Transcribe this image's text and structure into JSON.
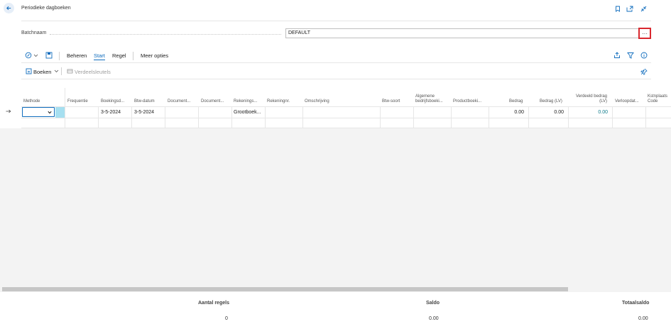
{
  "header": {
    "title": "Periodieke dagboeken"
  },
  "batch": {
    "label": "Batchnaam",
    "value": "DEFAULT",
    "lookup_label": "···"
  },
  "toolbar": {
    "manage": "Beheren",
    "start": "Start",
    "line": "Regel",
    "more": "Meer opties"
  },
  "subbar": {
    "post": "Boeken",
    "allocation": "Verdeelsleutels"
  },
  "columns": {
    "method": "Methode",
    "frequency": "Frequentie",
    "posting_date": "Boekingsd...",
    "vat_date": "Btw-datum",
    "doc_type": "Document...",
    "doc_no": "Document...",
    "account_type": "Rekenings...",
    "account_no": "Rekeningnr.",
    "description": "Omschrijving",
    "vat_type": "Btw-soort",
    "gen_bus_line1": "Algemene",
    "gen_bus_line2": "bedrijfsboeki...",
    "gen_prod": "Productboeki...",
    "amount": "Bedrag",
    "amount_lcy": "Bedrag (LV)",
    "alloc_line1": "Verdeeld bedrag",
    "alloc_line2": "(LV)",
    "expiry": "Verloopdat...",
    "cost_line1": "Kstnplaats",
    "cost_line2": "Code"
  },
  "row": {
    "posting_date": "3-5-2024",
    "vat_date": "3-5-2024",
    "account_type": "Grootboek...",
    "amount": "0.00",
    "amount_lcy": "0.00",
    "allocated": "0.00"
  },
  "footer": {
    "lines_label": "Aantal regels",
    "lines_value": "0",
    "balance_label": "Saldo",
    "balance_value": "0.00",
    "total_label": "Totaalsaldo",
    "total_value": "0.00"
  },
  "colors": {
    "accent": "#0f6cbd",
    "highlight_box": "#d9282f",
    "selected_cell": "#a6dff0",
    "link_value": "#0f7b8b"
  }
}
